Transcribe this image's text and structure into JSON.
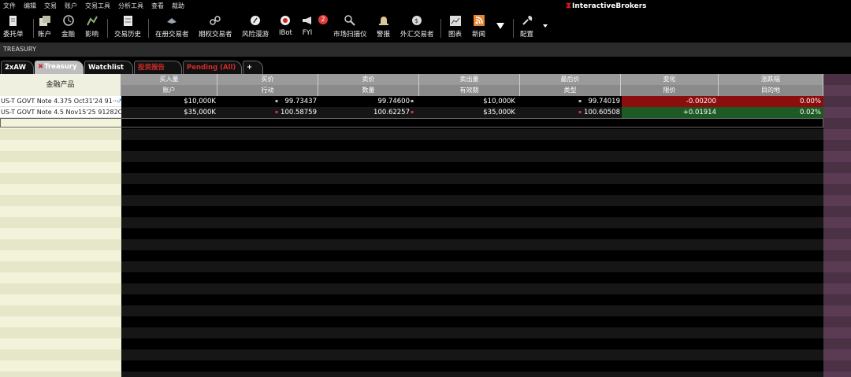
{
  "menu": [
    "文件",
    "编辑",
    "交易",
    "账户",
    "交易工具",
    "分析工具",
    "查看",
    "裁助"
  ],
  "brand": {
    "logo_text": "InteractiveBrokers",
    "logo_mark": "ib"
  },
  "toolbar": [
    {
      "label": "委托单",
      "icon": "order-icon"
    },
    {
      "label": "账户",
      "icon": "account-icon"
    },
    {
      "label": "金融",
      "icon": "finance-icon"
    },
    {
      "label": "影响",
      "icon": "impact-icon"
    },
    {
      "label": "交易历史",
      "icon": "trade-history-icon"
    },
    {
      "label": "在册交易者",
      "icon": "trader-icon"
    },
    {
      "label": "期权交易者",
      "icon": "options-trader-icon"
    },
    {
      "label": "风险漫游",
      "icon": "risk-navigator-icon"
    },
    {
      "label": "IBot",
      "icon": "ibot-icon"
    },
    {
      "label": "FYI",
      "icon": "megaphone-icon"
    },
    {
      "label": "市场扫描仪",
      "icon": "scanner-icon"
    },
    {
      "label": "警报",
      "icon": "alert-bell-icon"
    },
    {
      "label": "外汇交易者",
      "icon": "fx-trader-icon"
    },
    {
      "label": "图表",
      "icon": "chart-icon"
    },
    {
      "label": "新闻",
      "icon": "news-icon"
    },
    {
      "label": "",
      "icon": "dropdown-arrow-icon"
    },
    {
      "label": "配置",
      "icon": "wrench-icon"
    }
  ],
  "fyi_badge": "2",
  "window_title": "TREASURY",
  "tabs": [
    {
      "label": "2xAW"
    },
    {
      "label": "Treasury"
    },
    {
      "label": "Watchlist"
    },
    {
      "label": "投资报告"
    },
    {
      "label": "Pending (All)"
    },
    {
      "label": "+"
    }
  ],
  "headers": {
    "instrument": "金融产品",
    "row1": [
      "买入量",
      "买价",
      "卖价",
      "卖出量",
      "最后价",
      "变化",
      "涨跌幅"
    ],
    "row2": [
      "账户",
      "行动",
      "数量",
      "有效期",
      "类型",
      "限价",
      "目的地"
    ]
  },
  "rows": [
    {
      "instrument": "US-T GOVT Note 4.375 Oct31'24 91···",
      "bid_size": "$10,000K",
      "bid": "99.73437",
      "ask": "99.74600",
      "ask_size": "$10,000K",
      "last": "99.74019",
      "change": "-0.00200",
      "change_pct": "0.00%"
    },
    {
      "instrument": "US-T GOVT Note 4.5 Nov15'25 91282CF···",
      "bid_size": "$35,000K",
      "bid": "100.58759",
      "ask": "100.62257",
      "ask_size": "$35,000K",
      "last": "100.60508",
      "change": "+0.01914",
      "change_pct": "0.02%"
    }
  ]
}
